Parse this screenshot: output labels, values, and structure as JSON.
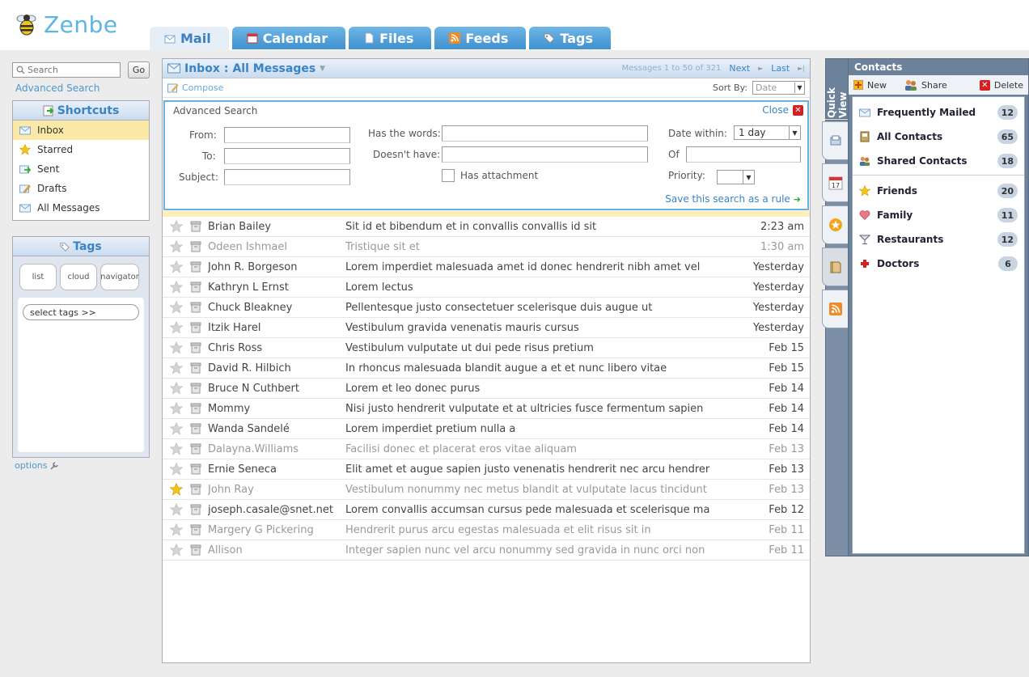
{
  "app": {
    "name": "Zenbe"
  },
  "tabs": [
    {
      "label": "Mail",
      "icon": "mail-icon",
      "active": true
    },
    {
      "label": "Calendar",
      "icon": "calendar-icon",
      "active": false
    },
    {
      "label": "Files",
      "icon": "file-icon",
      "active": false
    },
    {
      "label": "Feeds",
      "icon": "rss-icon",
      "active": false
    },
    {
      "label": "Tags",
      "icon": "tag-icon",
      "active": false
    }
  ],
  "search": {
    "placeholder": "Search",
    "go_label": "Go",
    "advanced_link": "Advanced Search"
  },
  "shortcuts": {
    "title": "Shortcuts",
    "items": [
      {
        "label": "Inbox",
        "icon": "envelope-icon",
        "selected": true
      },
      {
        "label": "Starred",
        "icon": "star-icon",
        "selected": false
      },
      {
        "label": "Sent",
        "icon": "sent-icon",
        "selected": false
      },
      {
        "label": "Drafts",
        "icon": "drafts-icon",
        "selected": false
      },
      {
        "label": "All Messages",
        "icon": "envelope-icon",
        "selected": false
      }
    ]
  },
  "tags_panel": {
    "title": "Tags",
    "modes": [
      "list",
      "cloud",
      "navigator"
    ],
    "select_placeholder": "select tags >>",
    "options_label": "options"
  },
  "mail": {
    "folder": "Inbox",
    "view": "All Messages",
    "count_text": "Messages 1 to 50 of 321",
    "next_label": "Next",
    "last_label": "Last",
    "compose_label": "Compose",
    "sort_label": "Sort By:",
    "sort_value": "Date"
  },
  "advanced_search": {
    "title": "Advanced Search",
    "close_label": "Close",
    "from_label": "From:",
    "to_label": "To:",
    "subject_label": "Subject:",
    "has_words_label": "Has the words:",
    "doesnt_have_label": "Doesn't have:",
    "has_attachment_label": "Has attachment",
    "date_within_label": "Date within:",
    "date_within_value": "1 day",
    "of_label": "Of",
    "priority_label": "Priority:",
    "save_rule_label": "Save this search as a rule"
  },
  "messages": [
    {
      "from": "Brian Bailey",
      "subject": "Sit id et bibendum et in convallis convallis id sit",
      "date": "2:23 am",
      "read": false,
      "starred": false
    },
    {
      "from": "Odeen Ishmael",
      "subject": "Tristique sit et",
      "date": "1:30 am",
      "read": true,
      "starred": false
    },
    {
      "from": "John R. Borgeson",
      "subject": "Lorem imperdiet malesuada amet id donec hendrerit nibh amet vel",
      "date": "Yesterday",
      "read": false,
      "starred": false
    },
    {
      "from": "Kathryn L Ernst",
      "subject": "Lorem lectus",
      "date": "Yesterday",
      "read": false,
      "starred": false
    },
    {
      "from": "Chuck Bleakney",
      "subject": "Pellentesque justo consectetuer scelerisque duis augue ut",
      "date": "Yesterday",
      "read": false,
      "starred": false
    },
    {
      "from": "Itzik Harel",
      "subject": "Vestibulum gravida venenatis mauris cursus",
      "date": "Yesterday",
      "read": false,
      "starred": false
    },
    {
      "from": "Chris Ross",
      "subject": "Vestibulum vulputate ut dui pede risus pretium",
      "date": "Feb 15",
      "read": false,
      "starred": false
    },
    {
      "from": "David R. Hilbich",
      "subject": "In rhoncus malesuada blandit augue a et et nunc libero vitae",
      "date": "Feb 15",
      "read": false,
      "starred": false
    },
    {
      "from": "Bruce N Cuthbert",
      "subject": "Lorem et leo donec purus",
      "date": "Feb 14",
      "read": false,
      "starred": false
    },
    {
      "from": "Mommy",
      "subject": "Nisi justo hendrerit vulputate et at ultricies fusce fermentum sapien",
      "date": "Feb 14",
      "read": false,
      "starred": false
    },
    {
      "from": "Wanda Sandelé",
      "subject": "Lorem imperdiet pretium nulla a",
      "date": "Feb 14",
      "read": false,
      "starred": false
    },
    {
      "from": "Dalayna.Williams",
      "subject": "Facilisi donec et placerat eros vitae aliquam",
      "date": "Feb 13",
      "read": true,
      "starred": false
    },
    {
      "from": "Ernie Seneca",
      "subject": "Elit amet et augue sapien justo venenatis hendrerit nec arcu hendrer",
      "date": "Feb 13",
      "read": false,
      "starred": false
    },
    {
      "from": "John Ray",
      "subject": "Vestibulum nonummy nec metus blandit at vulputate lacus tincidunt",
      "date": "Feb 13",
      "read": true,
      "starred": true
    },
    {
      "from": "joseph.casale@snet.net",
      "subject": "Lorem convallis accumsan cursus pede malesuada et scelerisque ma",
      "date": "Feb 12",
      "read": false,
      "starred": false
    },
    {
      "from": "Margery G Pickering",
      "subject": "Hendrerit purus arcu egestas malesuada et elit risus sit in",
      "date": "Feb 11",
      "read": true,
      "starred": false
    },
    {
      "from": "Allison",
      "subject": "Integer sapien nunc vel arcu nonummy sed gravida in nunc orci non",
      "date": "Feb 11",
      "read": true,
      "starred": false
    }
  ],
  "quick_view": {
    "label": "Quick View",
    "tabs": [
      "inbox-tray-icon",
      "calendar-icon",
      "starred-icon",
      "notes-icon",
      "rss-icon"
    ]
  },
  "contacts": {
    "title": "Contacts",
    "new_label": "New",
    "share_label": "Share",
    "delete_label": "Delete",
    "groups": [
      {
        "label": "Frequently Mailed",
        "count": "12",
        "icon": "mail-icon"
      },
      {
        "label": "All Contacts",
        "count": "65",
        "icon": "address-book-icon"
      },
      {
        "label": "Shared Contacts",
        "count": "18",
        "icon": "people-icon"
      }
    ],
    "categories": [
      {
        "label": "Friends",
        "count": "20",
        "icon": "star-icon"
      },
      {
        "label": "Family",
        "count": "11",
        "icon": "heart-icon"
      },
      {
        "label": "Restaurants",
        "count": "12",
        "icon": "cocktail-icon"
      },
      {
        "label": "Doctors",
        "count": "6",
        "icon": "red-cross-icon"
      }
    ]
  },
  "colors": {
    "accent": "#3a84c6",
    "tab": "#4a9ad6",
    "selected": "#fbe9a8",
    "contacts_bg": "#6c819a"
  }
}
